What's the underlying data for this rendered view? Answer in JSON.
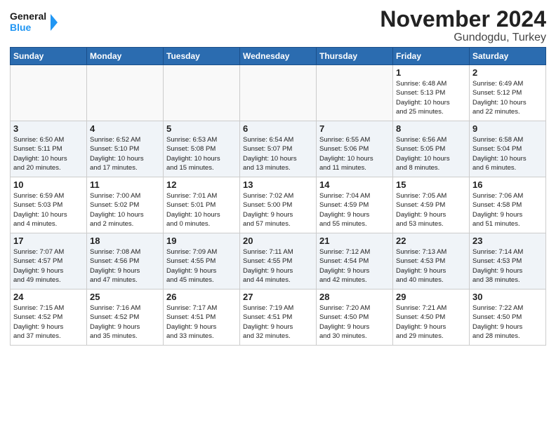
{
  "header": {
    "logo_general": "General",
    "logo_blue": "Blue",
    "month": "November 2024",
    "location": "Gundogdu, Turkey"
  },
  "days_of_week": [
    "Sunday",
    "Monday",
    "Tuesday",
    "Wednesday",
    "Thursday",
    "Friday",
    "Saturday"
  ],
  "weeks": [
    [
      {
        "day": "",
        "info": ""
      },
      {
        "day": "",
        "info": ""
      },
      {
        "day": "",
        "info": ""
      },
      {
        "day": "",
        "info": ""
      },
      {
        "day": "",
        "info": ""
      },
      {
        "day": "1",
        "info": "Sunrise: 6:48 AM\nSunset: 5:13 PM\nDaylight: 10 hours\nand 25 minutes."
      },
      {
        "day": "2",
        "info": "Sunrise: 6:49 AM\nSunset: 5:12 PM\nDaylight: 10 hours\nand 22 minutes."
      }
    ],
    [
      {
        "day": "3",
        "info": "Sunrise: 6:50 AM\nSunset: 5:11 PM\nDaylight: 10 hours\nand 20 minutes."
      },
      {
        "day": "4",
        "info": "Sunrise: 6:52 AM\nSunset: 5:10 PM\nDaylight: 10 hours\nand 17 minutes."
      },
      {
        "day": "5",
        "info": "Sunrise: 6:53 AM\nSunset: 5:08 PM\nDaylight: 10 hours\nand 15 minutes."
      },
      {
        "day": "6",
        "info": "Sunrise: 6:54 AM\nSunset: 5:07 PM\nDaylight: 10 hours\nand 13 minutes."
      },
      {
        "day": "7",
        "info": "Sunrise: 6:55 AM\nSunset: 5:06 PM\nDaylight: 10 hours\nand 11 minutes."
      },
      {
        "day": "8",
        "info": "Sunrise: 6:56 AM\nSunset: 5:05 PM\nDaylight: 10 hours\nand 8 minutes."
      },
      {
        "day": "9",
        "info": "Sunrise: 6:58 AM\nSunset: 5:04 PM\nDaylight: 10 hours\nand 6 minutes."
      }
    ],
    [
      {
        "day": "10",
        "info": "Sunrise: 6:59 AM\nSunset: 5:03 PM\nDaylight: 10 hours\nand 4 minutes."
      },
      {
        "day": "11",
        "info": "Sunrise: 7:00 AM\nSunset: 5:02 PM\nDaylight: 10 hours\nand 2 minutes."
      },
      {
        "day": "12",
        "info": "Sunrise: 7:01 AM\nSunset: 5:01 PM\nDaylight: 10 hours\nand 0 minutes."
      },
      {
        "day": "13",
        "info": "Sunrise: 7:02 AM\nSunset: 5:00 PM\nDaylight: 9 hours\nand 57 minutes."
      },
      {
        "day": "14",
        "info": "Sunrise: 7:04 AM\nSunset: 4:59 PM\nDaylight: 9 hours\nand 55 minutes."
      },
      {
        "day": "15",
        "info": "Sunrise: 7:05 AM\nSunset: 4:59 PM\nDaylight: 9 hours\nand 53 minutes."
      },
      {
        "day": "16",
        "info": "Sunrise: 7:06 AM\nSunset: 4:58 PM\nDaylight: 9 hours\nand 51 minutes."
      }
    ],
    [
      {
        "day": "17",
        "info": "Sunrise: 7:07 AM\nSunset: 4:57 PM\nDaylight: 9 hours\nand 49 minutes."
      },
      {
        "day": "18",
        "info": "Sunrise: 7:08 AM\nSunset: 4:56 PM\nDaylight: 9 hours\nand 47 minutes."
      },
      {
        "day": "19",
        "info": "Sunrise: 7:09 AM\nSunset: 4:55 PM\nDaylight: 9 hours\nand 45 minutes."
      },
      {
        "day": "20",
        "info": "Sunrise: 7:11 AM\nSunset: 4:55 PM\nDaylight: 9 hours\nand 44 minutes."
      },
      {
        "day": "21",
        "info": "Sunrise: 7:12 AM\nSunset: 4:54 PM\nDaylight: 9 hours\nand 42 minutes."
      },
      {
        "day": "22",
        "info": "Sunrise: 7:13 AM\nSunset: 4:53 PM\nDaylight: 9 hours\nand 40 minutes."
      },
      {
        "day": "23",
        "info": "Sunrise: 7:14 AM\nSunset: 4:53 PM\nDaylight: 9 hours\nand 38 minutes."
      }
    ],
    [
      {
        "day": "24",
        "info": "Sunrise: 7:15 AM\nSunset: 4:52 PM\nDaylight: 9 hours\nand 37 minutes."
      },
      {
        "day": "25",
        "info": "Sunrise: 7:16 AM\nSunset: 4:52 PM\nDaylight: 9 hours\nand 35 minutes."
      },
      {
        "day": "26",
        "info": "Sunrise: 7:17 AM\nSunset: 4:51 PM\nDaylight: 9 hours\nand 33 minutes."
      },
      {
        "day": "27",
        "info": "Sunrise: 7:19 AM\nSunset: 4:51 PM\nDaylight: 9 hours\nand 32 minutes."
      },
      {
        "day": "28",
        "info": "Sunrise: 7:20 AM\nSunset: 4:50 PM\nDaylight: 9 hours\nand 30 minutes."
      },
      {
        "day": "29",
        "info": "Sunrise: 7:21 AM\nSunset: 4:50 PM\nDaylight: 9 hours\nand 29 minutes."
      },
      {
        "day": "30",
        "info": "Sunrise: 7:22 AM\nSunset: 4:50 PM\nDaylight: 9 hours\nand 28 minutes."
      }
    ]
  ]
}
